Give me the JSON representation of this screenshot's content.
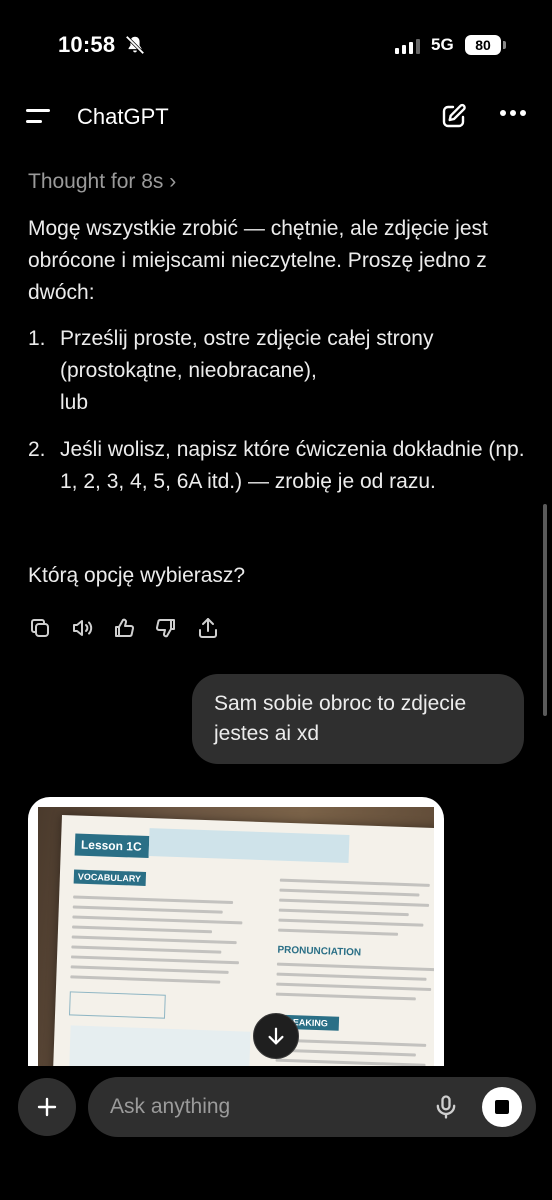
{
  "status_bar": {
    "time": "10:58",
    "network": "5G",
    "battery": "80",
    "icons": [
      "bell-slash-icon",
      "signal-icon"
    ]
  },
  "header": {
    "title": "ChatGPT",
    "icons": [
      "menu-icon",
      "new-chat-icon",
      "more-icon"
    ]
  },
  "assistant": {
    "thought_label": "Thought for 8s",
    "paragraph_1": "Mogę wszystkie zrobić — chętnie, ale zdjęcie jest obrócone i miejscami nieczytelne. Proszę jedno z dwóch:",
    "list": [
      {
        "num": "1.",
        "text": "Prześlij proste, ostre zdjęcie całej strony (prostokątne, nieobracane),",
        "text_2": "lub"
      },
      {
        "num": "2.",
        "text": "Jeśli wolisz, napisz które ćwiczenia dokładnie (np. 1, 2, 3, 4, 5, 6A itd.) — zrobię je od razu."
      }
    ],
    "paragraph_2": "Którą opcję wybierasz?",
    "actions": [
      "copy-icon",
      "read-aloud-icon",
      "thumbs-up-icon",
      "thumbs-down-icon",
      "share-icon"
    ]
  },
  "user": {
    "message": "Sam sobie obroc to zdjecie jestes ai xd"
  },
  "attachment": {
    "lesson": "Lesson 1C",
    "vocabulary": "VOCABULARY",
    "pronunciation": "PRONUNCIATION",
    "speaking": "SPEAKING"
  },
  "composer": {
    "placeholder": "Ask anything"
  }
}
